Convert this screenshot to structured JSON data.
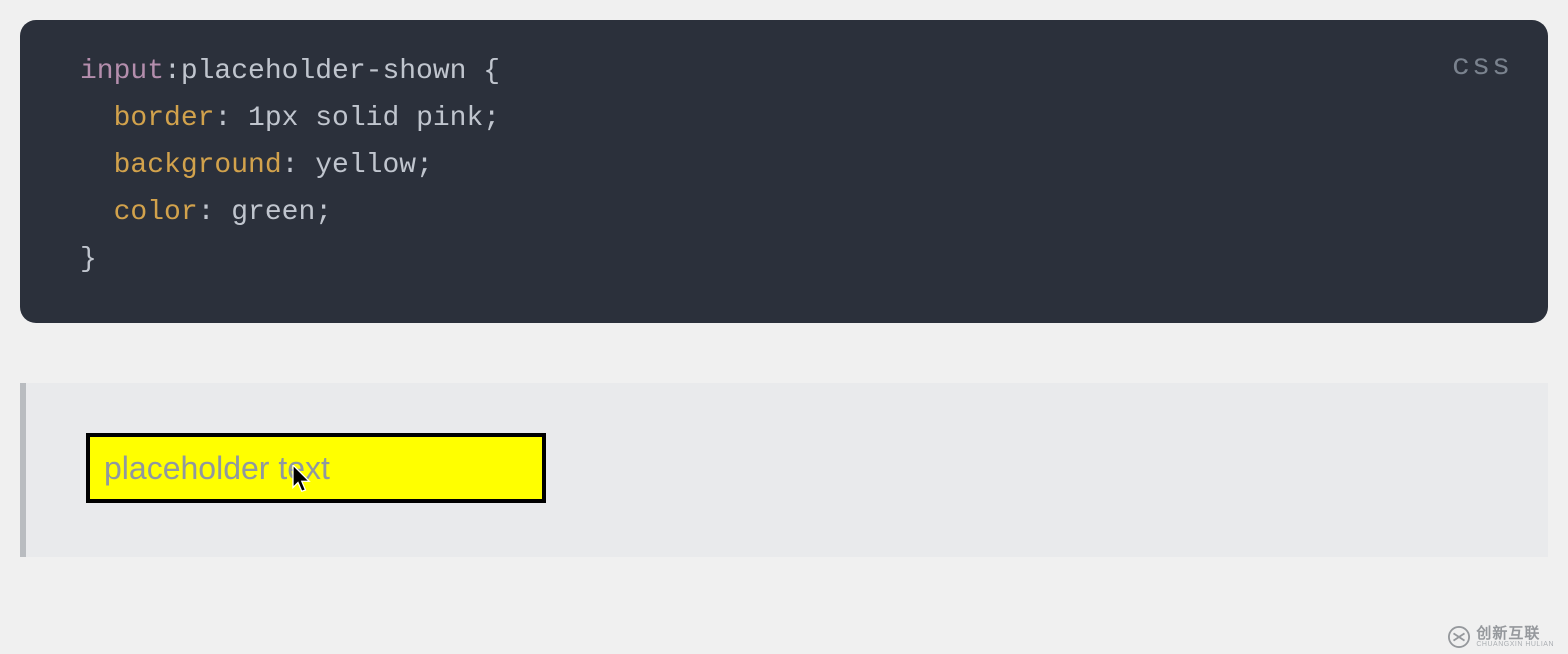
{
  "code": {
    "language": "css",
    "lines": {
      "l1_selector": "input",
      "l1_pseudo": ":placeholder-shown",
      "l1_open": " {",
      "l2_indent": "  ",
      "l2_prop": "border",
      "l2_colon": ": ",
      "l2_value": "1px solid pink",
      "l2_semi": ";",
      "l3_indent": "  ",
      "l3_prop": "background",
      "l3_colon": ": ",
      "l3_value": "yellow",
      "l3_semi": ";",
      "l4_indent": "  ",
      "l4_prop": "color",
      "l4_colon": ": ",
      "l4_value": "green",
      "l4_semi": ";",
      "l5_close": "}"
    }
  },
  "example": {
    "placeholder": "placeholder text"
  },
  "watermark": {
    "brand": "创新互联",
    "sub": "CHUANGXIN HULIAN"
  }
}
